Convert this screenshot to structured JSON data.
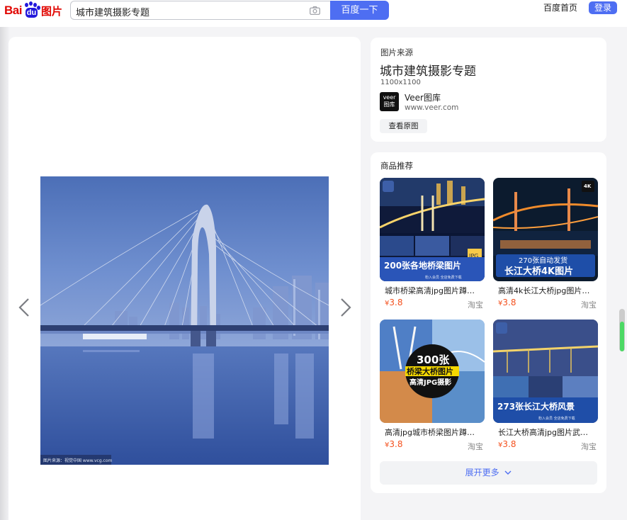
{
  "header": {
    "logo": {
      "bai": "Bai",
      "du": "du",
      "images": "图片"
    },
    "search_query": "城市建筑摄影专题",
    "search_button": "百度一下",
    "home_link": "百度首页",
    "login_button": "登录"
  },
  "viewer": {
    "watermark": "图片来源：视觉中国 www.vcg.com",
    "prev_icon": "chevron-left-icon",
    "next_icon": "chevron-right-icon"
  },
  "source": {
    "label": "图片来源",
    "title": "城市建筑摄影专题",
    "size": "1100x1100",
    "logo_text_1": "veer",
    "logo_text_2": "图库",
    "site_name": "Veer图库",
    "site_url": "www.veer.com",
    "view_original": "查看原图"
  },
  "recommend": {
    "title": "商品推荐",
    "currency": "¥",
    "products": [
      {
        "name": "城市桥梁高清jpg图片蹲…",
        "price": "3.8",
        "shop": "淘宝",
        "banner": "200张各地桥梁图片",
        "sub": "粉入会员 全店免费下载",
        "badge": "JPG"
      },
      {
        "name": "高清4k长江大桥jpg图片…",
        "price": "3.8",
        "shop": "淘宝",
        "banner_top": "270张自动发货",
        "banner": "长江大桥4K图片",
        "badge": "4K"
      },
      {
        "name": "高清jpg城市桥梁图片蹲…",
        "price": "3.8",
        "shop": "淘宝",
        "circle_1": "300张",
        "circle_2": "桥梁大桥图片",
        "circle_3": "高清JPG摄影"
      },
      {
        "name": "长江大桥高清jpg图片武…",
        "price": "3.8",
        "shop": "淘宝",
        "banner": "273张长江大桥风景",
        "sub": "粉入会员 全店免费下载"
      }
    ],
    "expand": "展开更多"
  },
  "colors": {
    "brand_blue": "#4e6ef2",
    "brand_red": "#e10601",
    "price_orange": "#f4511e"
  }
}
